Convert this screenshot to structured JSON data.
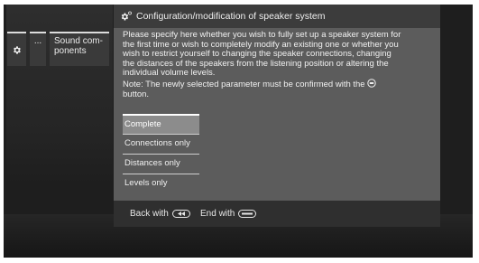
{
  "sidebar": {
    "items": [
      {
        "label": "",
        "icon": "gear-icon"
      },
      {
        "label": "..."
      },
      {
        "label_lines": [
          "Sound com-",
          "ponents"
        ]
      }
    ]
  },
  "dialog": {
    "title": "Configuration/modification of speaker system",
    "title_icon": "gear-icon",
    "description_lines": [
      "Please specify here whether you wish to fully set up a speaker system for",
      "the first time or wish to completely modify an existing one or whether you",
      "wish to restrict yourself to changing the speaker connections, changing",
      "the distances of the speakers from the listening position or altering the",
      "individual volume levels."
    ],
    "note_line1": "Note: The newly selected parameter must be confirmed with the",
    "note_line2": "button.",
    "note_button_icon": "ok-button-icon",
    "options": [
      {
        "label": "Complete",
        "selected": true
      },
      {
        "label": "Connections only",
        "selected": false
      },
      {
        "label": "Distances only",
        "selected": false
      },
      {
        "label": "Levels only",
        "selected": false
      }
    ],
    "footer": {
      "back_label": "Back with",
      "back_icon": "rewind-button-icon",
      "end_label": "End with",
      "end_icon": "back-button-icon"
    }
  },
  "colors": {
    "screen_bg": "#1e1e1e",
    "dialog_bg": "#5c5c5c",
    "header_bg": "#3c3c3c",
    "selected_option_bg": "#8c8c8c",
    "footer_bg": "#2f2f2f"
  }
}
